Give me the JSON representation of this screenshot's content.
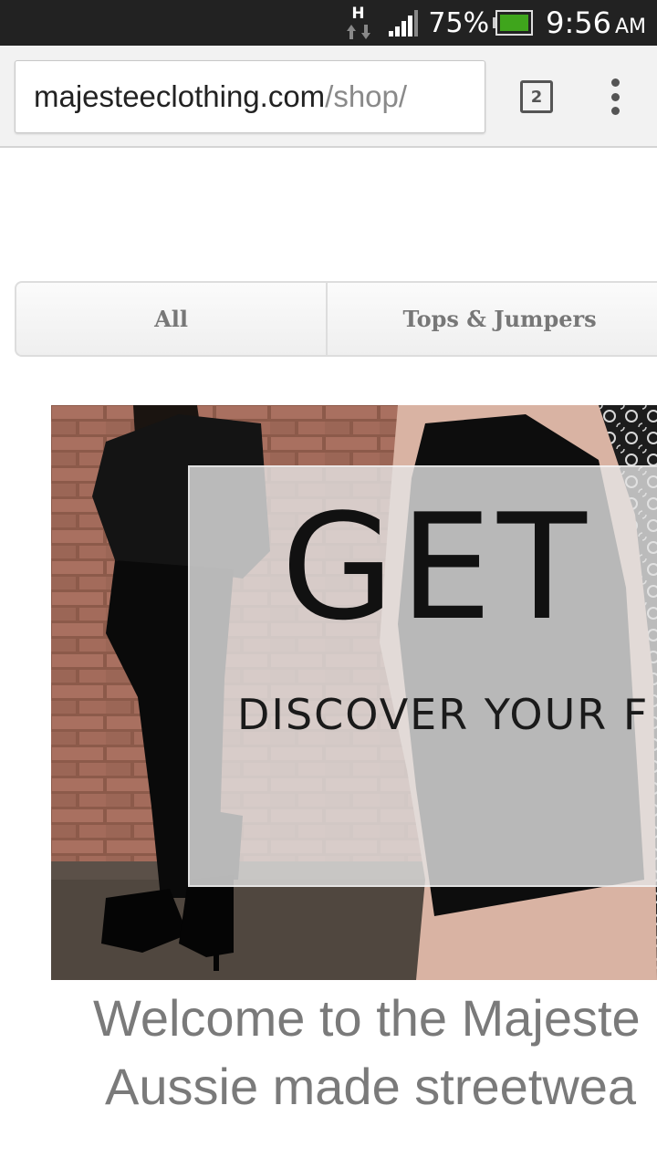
{
  "status_bar": {
    "network_type": "H",
    "battery_percent": "75%",
    "time": "9:56",
    "ampm": "AM"
  },
  "browser": {
    "url_domain": "majesteeclothing.com",
    "url_path": "/shop/",
    "tab_count": "2"
  },
  "category_nav": {
    "tabs": [
      {
        "label": "All"
      },
      {
        "label": "Tops & Jumpers"
      }
    ]
  },
  "banner": {
    "heading": "GET",
    "subheading": "DISCOVER YOUR F"
  },
  "welcome": {
    "line1": "Welcome to the Majeste",
    "line2": "Aussie made streetwea"
  },
  "colors": {
    "status_bar": "#222222",
    "toolbar": "#f2f2f2",
    "welcome_text": "#7a7a7a",
    "tab_text": "#777777",
    "battery_fill": "#3fa51c"
  },
  "icons": [
    "network-h-icon",
    "signal-icon",
    "battery-icon",
    "tabs-icon",
    "overflow-menu-icon"
  ]
}
